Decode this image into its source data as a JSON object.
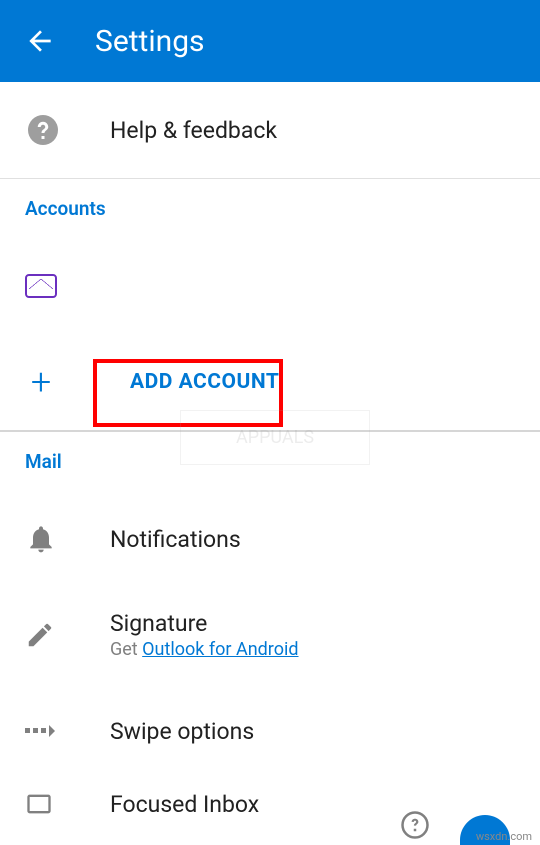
{
  "header": {
    "title": "Settings"
  },
  "helpRow": {
    "label": "Help & feedback"
  },
  "sections": {
    "accounts": "Accounts",
    "mail": "Mail"
  },
  "addAccount": {
    "label": "ADD ACCOUNT"
  },
  "mailItems": {
    "notifications": "Notifications",
    "signature": {
      "title": "Signature",
      "prefix": "Get ",
      "link": "Outlook for Android"
    },
    "swipe": "Swipe options",
    "focused": "Focused Inbox"
  },
  "attribution": "wsxdn.com"
}
